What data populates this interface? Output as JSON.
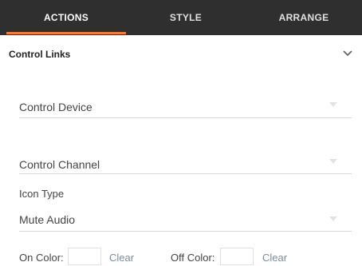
{
  "tabs": {
    "actions": "ACTIONS",
    "style": "STYLE",
    "arrange": "ARRANGE"
  },
  "section": {
    "title": "Control Links"
  },
  "fields": {
    "control_device": "Control Device",
    "control_channel": "Control Channel",
    "icon_type_label": "Icon Type",
    "icon_type_value": "Mute Audio"
  },
  "colors": {
    "on_label": "On Color:",
    "off_label": "Off Color:",
    "clear": "Clear",
    "accent": "#ff7a2a",
    "tabbar_bg": "#2f2f2f"
  }
}
